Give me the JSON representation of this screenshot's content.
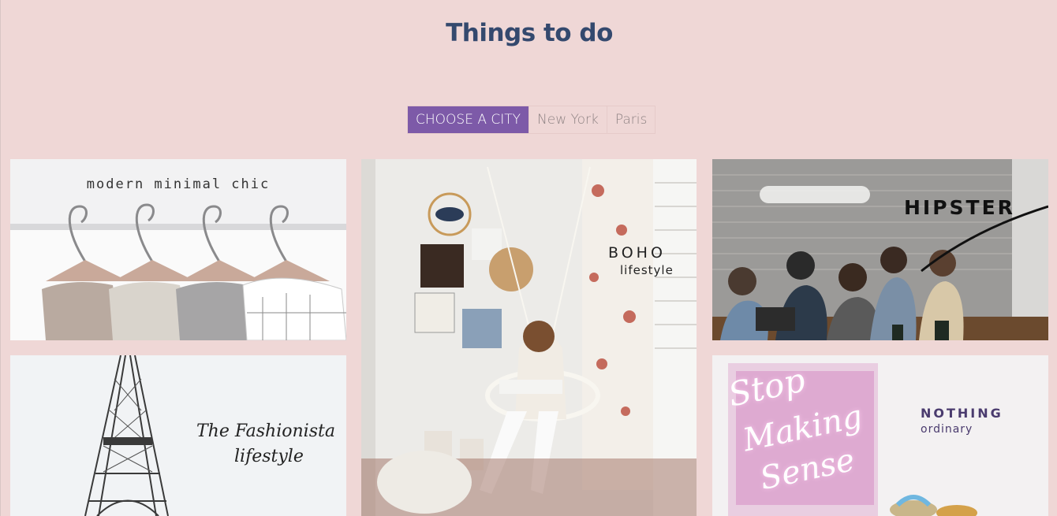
{
  "page": {
    "title": "Things to do"
  },
  "filters": {
    "items": [
      {
        "label": "CHOOSE A CITY",
        "active": true
      },
      {
        "label": "New York",
        "active": false
      },
      {
        "label": "Paris",
        "active": false
      }
    ]
  },
  "tiles": [
    {
      "text": "modern minimal chic"
    },
    {
      "text_line1": "BOHO",
      "text_line2": "lifestyle"
    },
    {
      "text": "HIPSTER"
    },
    {
      "text_line1": "The Fashionista",
      "text_line2": "lifestyle"
    },
    {
      "text_line1": "NOTHING",
      "text_line2": "ordinary",
      "neon_line1": "Stop",
      "neon_line2": "Making",
      "neon_line3": "Sense"
    }
  ],
  "colors": {
    "background": "#efd7d6",
    "title": "#34496e",
    "active_filter": "#7d5aa8"
  }
}
